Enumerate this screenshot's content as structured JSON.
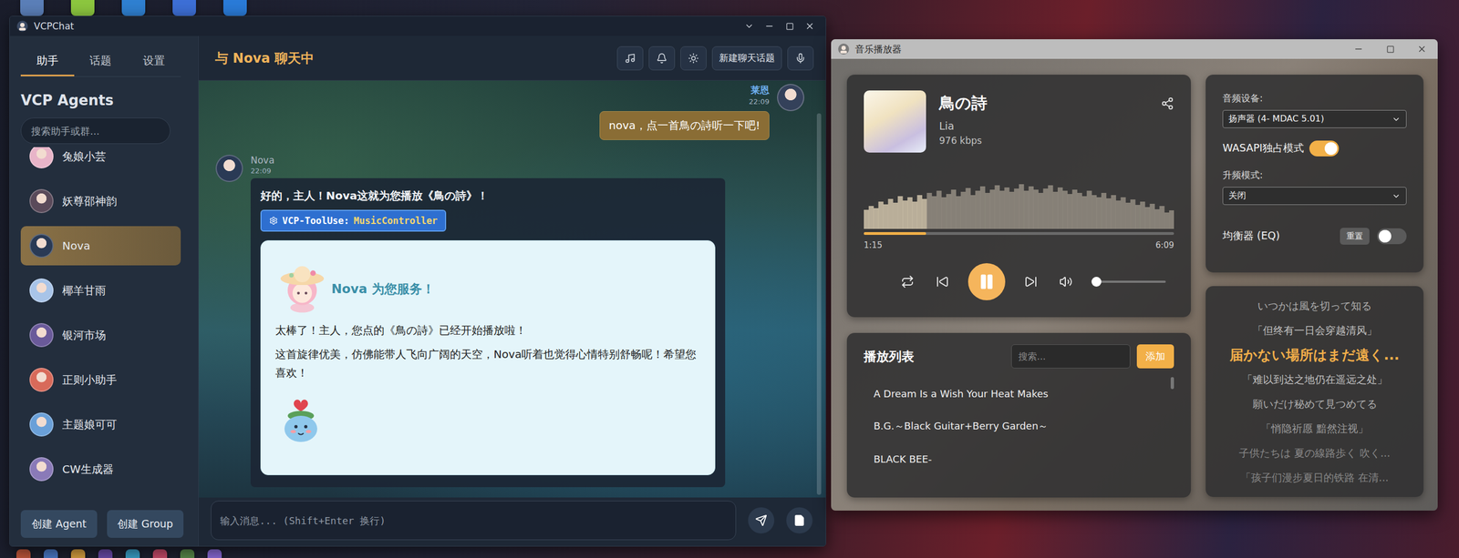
{
  "desktop": {
    "top_icons": [
      {
        "color": "#5b7fb8"
      },
      {
        "color": "#8cc63f"
      },
      {
        "color": "#2f80d1"
      },
      {
        "color": "#3d6fd6"
      },
      {
        "color": "#2a7bd8"
      }
    ],
    "bottom_icons": [
      {
        "color": "#c0563a"
      },
      {
        "color": "#4a7ac8"
      },
      {
        "color": "#d8a040"
      },
      {
        "color": "#6a4aa8"
      },
      {
        "color": "#3aa0c8"
      },
      {
        "color": "#c84a6a"
      },
      {
        "color": "#5a8a4a"
      },
      {
        "color": "#8a6ad8"
      }
    ]
  },
  "chat_window": {
    "title": "VCPChat",
    "sidebar": {
      "tabs": [
        {
          "label": "助手",
          "selected": true
        },
        {
          "label": "话题",
          "selected": false
        },
        {
          "label": "设置",
          "selected": false
        }
      ],
      "heading": "VCP Agents",
      "search": {
        "placeholder": "搜索助手或群..."
      },
      "items": [
        {
          "name": "兔娘小芸",
          "selected": false,
          "color": "#e8b4c8"
        },
        {
          "name": "妖尊邵神韵",
          "selected": false,
          "color": "#5a4a5a"
        },
        {
          "name": "Nova",
          "selected": true,
          "color": "#2a3a55"
        },
        {
          "name": "椰羊甘雨",
          "selected": false,
          "color": "#a8c4e8"
        },
        {
          "name": "银河市场",
          "selected": false,
          "color": "#6a5a9a"
        },
        {
          "name": "正则小助手",
          "selected": false,
          "color": "#d86a5a"
        },
        {
          "name": "主题娘可可",
          "selected": false,
          "color": "#6aa0d8"
        },
        {
          "name": "CW生成器",
          "selected": false,
          "color": "#8a7ab8"
        }
      ],
      "buttons": [
        "创建 Agent",
        "创建 Group"
      ]
    },
    "header": {
      "title": "与 Nova 聊天中",
      "buttons": [
        {
          "kind": "icon"
        },
        {
          "kind": "icon"
        },
        {
          "kind": "icon"
        },
        {
          "kind": "text",
          "label": "新建聊天话题"
        },
        {
          "kind": "icon"
        }
      ]
    },
    "messages": [
      {
        "role": "user",
        "name": "莱恩",
        "time": "22:09",
        "text": "nova，点一首鳥の詩听一下吧!"
      },
      {
        "role": "assistant",
        "name": "Nova",
        "time": "22:09",
        "text": "好的，主人！Nova这就为您播放《鳥の詩》！",
        "tool": {
          "label": "VCP-ToolUse:",
          "name": "MusicController"
        },
        "card": {
          "title": "Nova 为您服务！",
          "paragraphs": [
            "太棒了！主人，您点的《鳥の詩》已经开始播放啦！",
            "这首旋律优美，仿佛能带人飞向广阔的天空，Nova听着也觉得心情特别舒畅呢！希望您喜欢！"
          ]
        }
      }
    ],
    "input": {
      "placeholder": "输入消息... (Shift+Enter 换行)"
    }
  },
  "music_window": {
    "title": "音乐播放器",
    "track": {
      "title": "鳥の詩",
      "artist": "Lia",
      "bitrate": "976 kbps",
      "elapsed": "1:15",
      "duration": "6:09",
      "playing": true
    },
    "progress": {
      "level": 0.2
    },
    "waveform": [
      0.35,
      0.42,
      0.38,
      0.5,
      0.45,
      0.55,
      0.48,
      0.6,
      0.52,
      0.58,
      0.5,
      0.62,
      0.55,
      0.66,
      0.6,
      0.7,
      0.58,
      0.64,
      0.72,
      0.6,
      0.68,
      0.75,
      0.62,
      0.7,
      0.78,
      0.66,
      0.72,
      0.8,
      0.7,
      0.76,
      0.68,
      0.74,
      0.82,
      0.7,
      0.78,
      0.72,
      0.66,
      0.74,
      0.8,
      0.68,
      0.76,
      0.7,
      0.64,
      0.72,
      0.66,
      0.6,
      0.7,
      0.62,
      0.58,
      0.66,
      0.56,
      0.62,
      0.52,
      0.58,
      0.48,
      0.54,
      0.44,
      0.5,
      0.4,
      0.46,
      0.36,
      0.42,
      0.3,
      0.34
    ],
    "volume": {
      "level": 0
    },
    "settings": {
      "device_label": "音频设备:",
      "device": "扬声器 (4- MDAC 5.01)",
      "wasapi": {
        "label": "WASAPI独占模式",
        "on": true
      },
      "upsample_label": "升频模式:",
      "upsample": "关闭",
      "eq": {
        "label": "均衡器 (EQ)",
        "reset": "重置",
        "on": false
      }
    },
    "playlist": {
      "title": "播放列表",
      "search_placeholder": "搜索...",
      "add": "添加",
      "items": [
        "A Dream Is a Wish Your Heat Makes",
        "B.G.～Black Guitar+Berry Garden～",
        "BLACK BEE-"
      ]
    },
    "lyrics": [
      {
        "text": "いつかは風を切って知る",
        "current": false
      },
      {
        "text": "「但终有一日会穿越清风」",
        "current": false
      },
      {
        "text": "届かない場所はまだ遠く...",
        "current": true
      },
      {
        "text": "「难以到达之地仍在遥远之处」",
        "current": false
      },
      {
        "text": "願いだけ秘めて見つめてる",
        "current": false
      },
      {
        "text": "「悄隐祈愿 黯然注视」",
        "current": false
      },
      {
        "text": "子供たちは 夏の線路歩く 吹く...",
        "current": false
      },
      {
        "text": "「孩子们漫步夏日的铁路 在清...",
        "current": false
      }
    ]
  }
}
